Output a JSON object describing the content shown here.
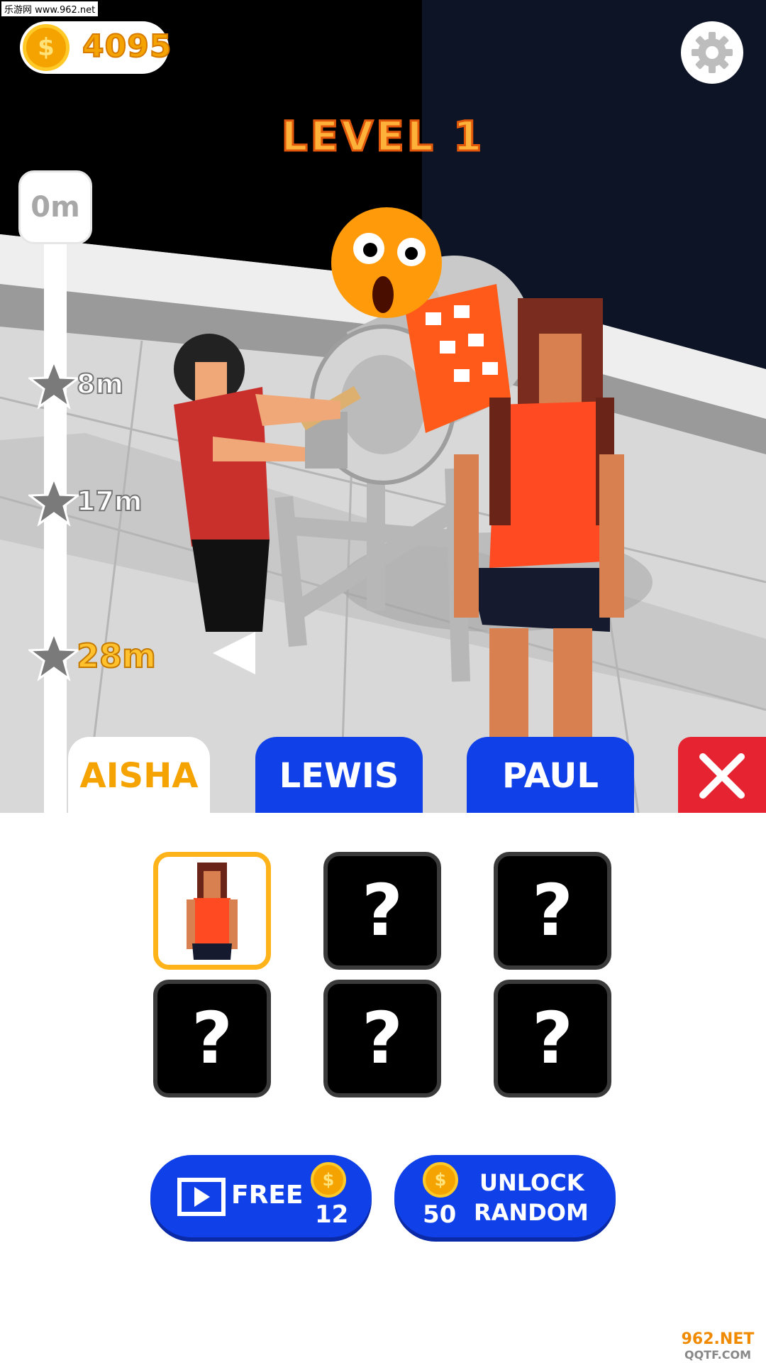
{
  "watermark_top": "乐游网 www.962.net",
  "coins": {
    "amount": "4095",
    "icon": "coin-icon"
  },
  "settings_icon": "gear-icon",
  "level": "LEVEL 1",
  "progress": {
    "start": "0m",
    "milestones": [
      {
        "label": "8m",
        "icon": "star-icon"
      },
      {
        "label": "17m",
        "icon": "star-icon"
      },
      {
        "label": "28m",
        "icon": "star-icon",
        "active": true
      }
    ]
  },
  "tabs": [
    {
      "label": "AISHA",
      "selected": true
    },
    {
      "label": "LEWIS",
      "selected": false
    },
    {
      "label": "PAUL",
      "selected": false
    }
  ],
  "close_icon": "close-icon",
  "characters": [
    {
      "state": "selected",
      "label": ""
    },
    {
      "state": "locked",
      "label": "?"
    },
    {
      "state": "locked",
      "label": "?"
    },
    {
      "state": "locked",
      "label": "?"
    },
    {
      "state": "locked",
      "label": "?"
    },
    {
      "state": "locked",
      "label": "?"
    }
  ],
  "buttons": {
    "free": {
      "label": "FREE",
      "amount": "12",
      "icon": "video-icon"
    },
    "unlock": {
      "price": "50",
      "line1": "UNLOCK",
      "line2": "RANDOM"
    }
  },
  "coin_symbol": "$",
  "watermark_bottom": {
    "line1": "962.NET",
    "line2": "QQTF.COM"
  },
  "colors": {
    "accent_blue": "#1040e8",
    "coin_orange": "#f5a300",
    "close_red": "#e62330",
    "selected_border": "#ffb31a"
  }
}
